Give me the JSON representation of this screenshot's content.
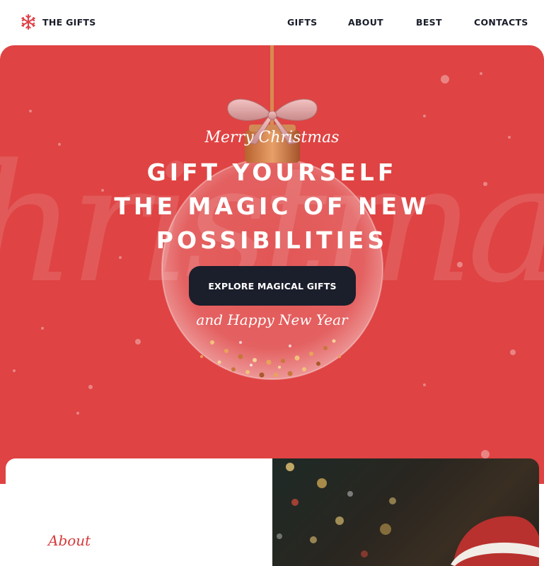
{
  "brand": {
    "name": "THE GIFTS",
    "icon": "snowflake-icon",
    "color": "#e0424a"
  },
  "nav": [
    {
      "label": "GIFTS"
    },
    {
      "label": "ABOUT"
    },
    {
      "label": "BEST"
    },
    {
      "label": "CONTACTS"
    }
  ],
  "hero": {
    "background": "#df4343",
    "script_top": "Merry Christmas",
    "headline_lines": [
      "GIFT YOURSELF",
      "THE MAGIC OF NEW",
      "POSSIBILITIES"
    ],
    "cta_label": "EXPLORE MAGICAL GIFTS",
    "script_bottom": "and Happy New Year"
  },
  "about": {
    "title": "About"
  }
}
